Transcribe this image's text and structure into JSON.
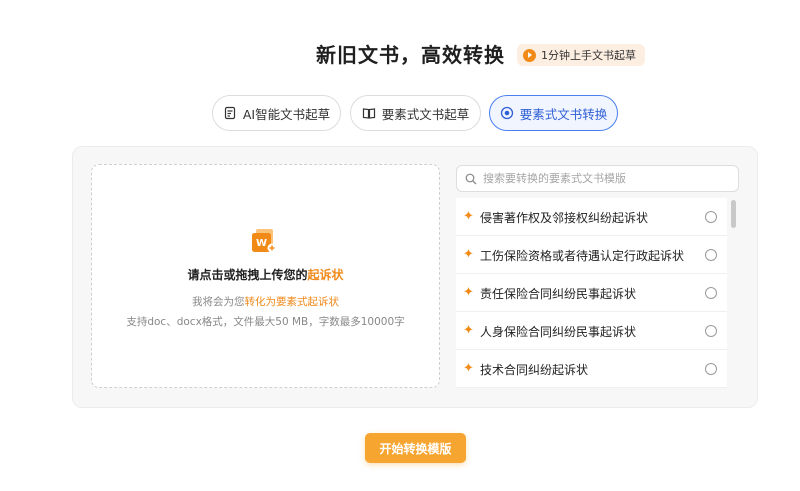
{
  "header": {
    "title": "新旧文书，高效转换",
    "badge_label": "1分钟上手文书起草",
    "badge_icon": "play-icon"
  },
  "tabs": [
    {
      "label": "AI智能文书起草",
      "icon": "document-edit-icon",
      "active": false
    },
    {
      "label": "要素式文书起草",
      "icon": "book-icon",
      "active": false
    },
    {
      "label": "要素式文书转换",
      "icon": "convert-icon",
      "active": true
    }
  ],
  "upload": {
    "title_prefix": "请点击或拖拽上传您的",
    "title_highlight": "起诉状",
    "sub_prefix": "我将会为您",
    "sub_highlight": "转化为要素式起诉状",
    "limits": "支持doc、docx格式，文件最大50 MB，字数最多10000字",
    "icon": "word-file-icon"
  },
  "search": {
    "placeholder": "搜索要转换的要素式文书模版",
    "value": ""
  },
  "templates": [
    {
      "label": "侵害著作权及邻接权纠纷起诉状",
      "selected": false
    },
    {
      "label": "工伤保险资格或者待遇认定行政起诉状",
      "selected": false
    },
    {
      "label": "责任保险合同纠纷民事起诉状",
      "selected": false
    },
    {
      "label": "人身保险合同纠纷民事起诉状",
      "selected": false
    },
    {
      "label": "技术合同纠纷起诉状",
      "selected": false
    }
  ],
  "actions": {
    "start_label": "开始转换模版"
  },
  "colors": {
    "accent": "#f08a1b",
    "button": "#f7a531",
    "active_tab_border": "#4a7ff0",
    "active_tab_text": "#2f5fd6"
  }
}
